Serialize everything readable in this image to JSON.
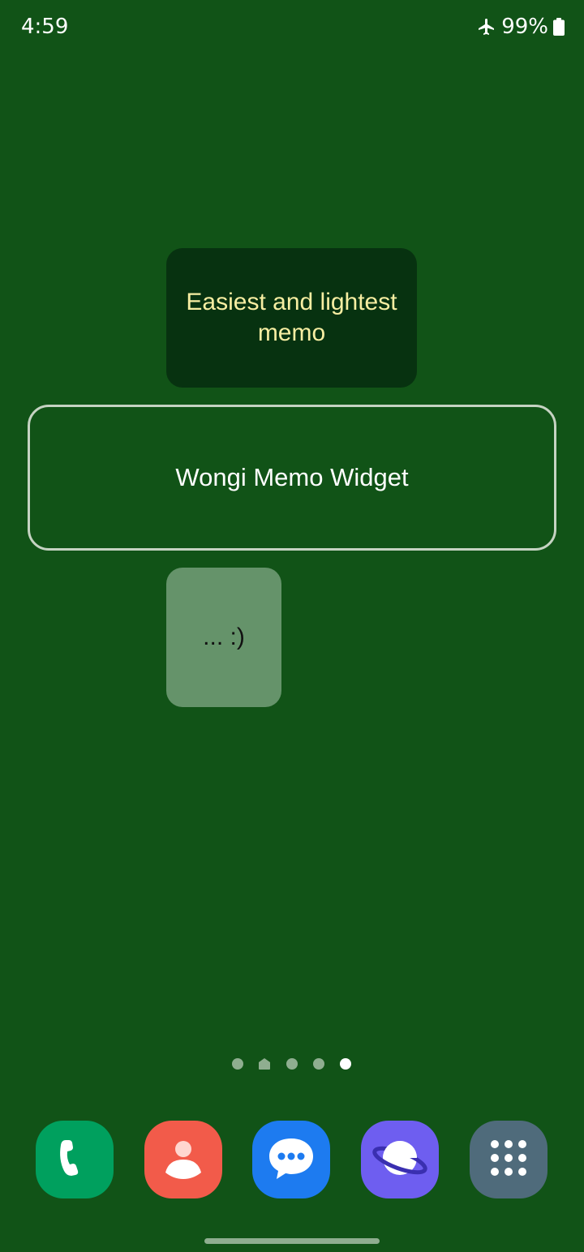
{
  "status_bar": {
    "time": "4:59",
    "battery": "99%",
    "icons": [
      "airplane-mode-icon",
      "battery-icon"
    ]
  },
  "widgets": {
    "memo_top": "Easiest and lightest memo",
    "memo_middle": "Wongi Memo Widget",
    "memo_bottom": "... :)"
  },
  "page_indicator": {
    "total_pages": 5,
    "active_page": 5,
    "home_page": 2
  },
  "dock": {
    "apps": [
      {
        "icon": "phone-icon",
        "color": "#00a05e"
      },
      {
        "icon": "contacts-icon",
        "color": "#f25b4a"
      },
      {
        "icon": "messages-icon",
        "color": "#1d7bf0"
      },
      {
        "icon": "internet-browser-icon",
        "color": "#6e5ef0"
      },
      {
        "icon": "app-drawer-icon",
        "color": "#4f6b7b"
      }
    ]
  },
  "colors": {
    "wallpaper": "#115317",
    "memo_top_bg": "#073210",
    "memo_top_text": "#f7eea2",
    "memo_middle_border": "#c5d3c2",
    "memo_bottom_bg": "#65936a"
  }
}
